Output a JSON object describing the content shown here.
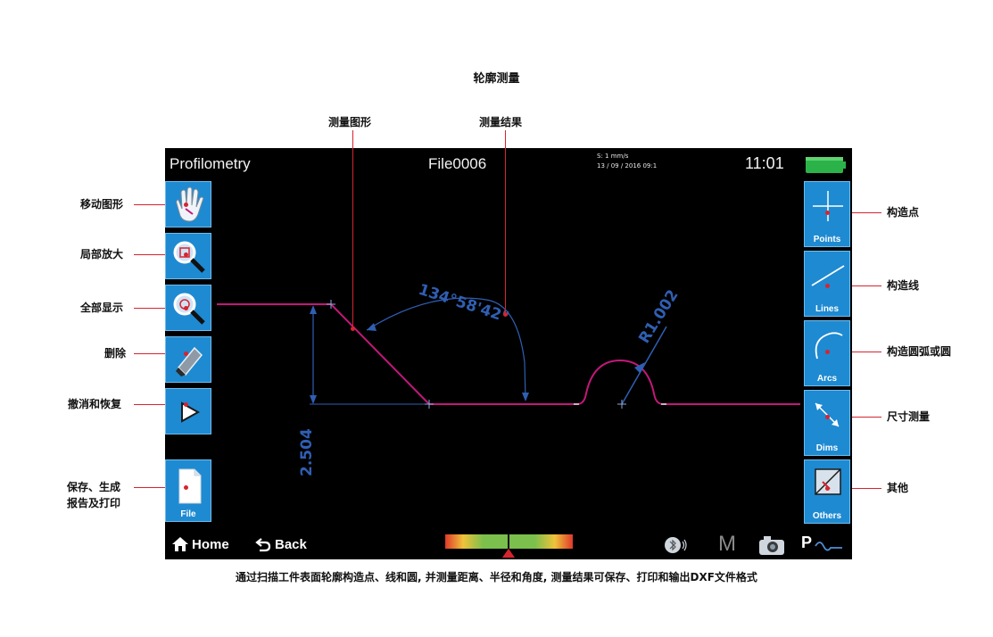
{
  "document": {
    "title": "轮廓测量",
    "top_labels": {
      "shape": "测量图形",
      "result": "测量结果"
    },
    "left_callouts": {
      "move": "移动图形",
      "zoom": "局部放大",
      "fit": "全部显示",
      "delete": "删除",
      "undo": "撤消和恢复",
      "save_line1": "保存、生成",
      "save_line2": "报告及打印"
    },
    "right_callouts": {
      "points": "构造点",
      "lines": "构造线",
      "arcs": "构造圆弧或圆",
      "dims": "尺寸测量",
      "others": "其他"
    },
    "caption": "通过扫描工件表面轮廓构造点、线和圆, 并测量距离、半径和角度, 测量结果可保存、打印和输出DXF文件格式"
  },
  "screen": {
    "app_title": "Profilometry",
    "file_name": "File0006",
    "speed": "S: 1 mm/s",
    "datetime": "13 / 09 / 2016  09:1",
    "clock": "11:01",
    "left_tools": [
      {
        "name": "move-tool",
        "icon": "hand-icon"
      },
      {
        "name": "zoom-tool",
        "icon": "magnifier-zoom-icon"
      },
      {
        "name": "fit-tool",
        "icon": "magnifier-fit-icon"
      },
      {
        "name": "delete-tool",
        "icon": "eraser-icon"
      },
      {
        "name": "undo-redo-tool",
        "icon": "play-icon"
      }
    ],
    "file_tool": {
      "label": "File",
      "icon": "document-icon"
    },
    "right_tools": {
      "points": "Points",
      "lines": "Lines",
      "arcs": "Arcs",
      "dims": "Dims",
      "others": "Others"
    },
    "measurements": {
      "angle": "134°58'42\"",
      "radius": "R1.002",
      "height": "2.504"
    },
    "bottom_bar": {
      "home": "Home",
      "back": "Back",
      "mode_letter": "M",
      "p_letter": "P"
    },
    "colors": {
      "button_blue": "#1e8ad2",
      "profile": "#c2187a",
      "dimension": "#2f5fb3",
      "callout": "#d6242f"
    }
  }
}
